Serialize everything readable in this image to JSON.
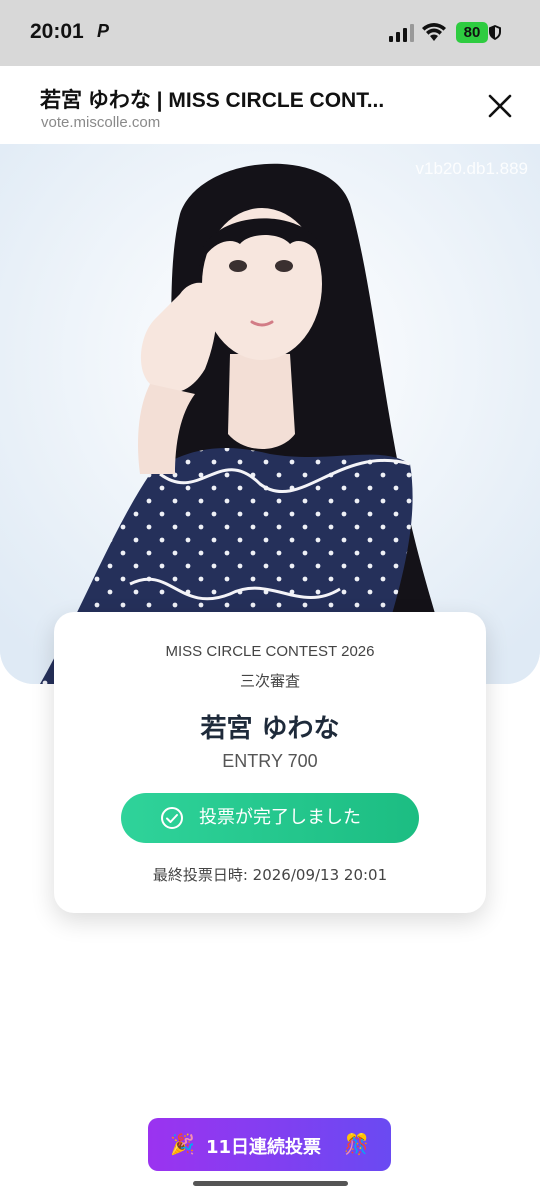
{
  "status_bar": {
    "time": "20:01",
    "app_icon": "p-icon",
    "battery": "80"
  },
  "browser": {
    "title": "若宮 ゆわな | MISS CIRCLE CONT...",
    "url": "vote.miscolle.com"
  },
  "hero": {
    "watermark": "v1b20.db1.889"
  },
  "card": {
    "contest": "MISS CIRCLE CONTEST 2026",
    "stage": "三次審査",
    "name": "若宮 ゆわな",
    "entry": "ENTRY 700",
    "vote_done": "投票が完了しました",
    "last_vote": "最終投票日時: 2026/09/13 20:01"
  },
  "streak": {
    "label": "11日連続投票",
    "left_icon": "party-popper-icon",
    "right_icon": "confetti-icon"
  },
  "colors": {
    "vote_button": "#1cbd82",
    "streak_button_start": "#9b33f0",
    "streak_button_end": "#6a4af2"
  }
}
